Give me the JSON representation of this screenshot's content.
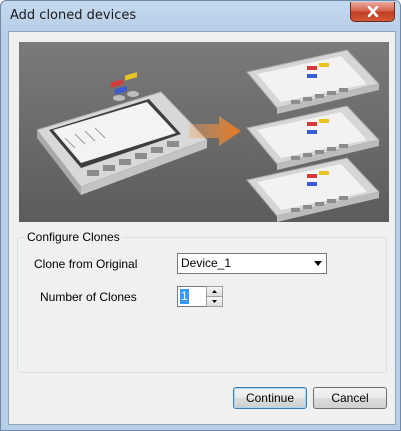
{
  "window": {
    "title": "Add cloned devices"
  },
  "illustration": {
    "colors": {
      "background": "#6b6b6b",
      "arrow": "#e8761d",
      "device_body": "#e4e4e4"
    }
  },
  "configure": {
    "group_title": "Configure Clones",
    "clone_label": "Clone from Original",
    "clone_value": "Device_1",
    "count_label": "Number of Clones",
    "count_value": "1"
  },
  "buttons": {
    "continue": "Continue",
    "cancel": "Cancel"
  },
  "icons": {
    "close": "close-icon",
    "dropdown": "chevron-down-icon",
    "spin_up": "arrow-up-icon",
    "spin_down": "arrow-down-icon"
  }
}
